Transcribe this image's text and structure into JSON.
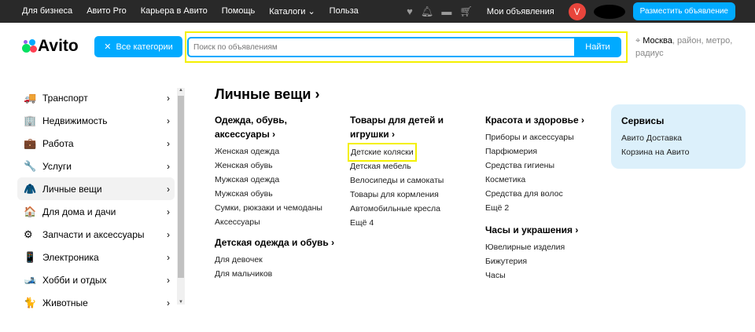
{
  "topbar": {
    "links": [
      "Для бизнеса",
      "Авито Pro",
      "Карьера в Авито",
      "Помощь",
      "Каталоги ⌄",
      "Польза"
    ],
    "my_ads": "Мои объявления",
    "avatar_letter": "V",
    "post_button": "Разместить объявление",
    "icons": [
      "heart-icon",
      "bell-icon",
      "chat-icon",
      "cart-icon"
    ]
  },
  "header": {
    "logo": "Avito",
    "categories_button": "Все категории",
    "search_placeholder": "Поиск по объявлениям",
    "search_button": "Найти",
    "location_city": "Москва",
    "location_rest": ", район, метро, радиус"
  },
  "sidebar": {
    "items": [
      {
        "label": "Транспорт",
        "icon": "🚚"
      },
      {
        "label": "Недвижимость",
        "icon": "🏢"
      },
      {
        "label": "Работа",
        "icon": "💼"
      },
      {
        "label": "Услуги",
        "icon": "🔧"
      },
      {
        "label": "Личные вещи",
        "icon": "🧥",
        "active": true
      },
      {
        "label": "Для дома и дачи",
        "icon": "🏠"
      },
      {
        "label": "Запчасти и аксессуары",
        "icon": "⚙"
      },
      {
        "label": "Электроника",
        "icon": "📱"
      },
      {
        "label": "Хобби и отдых",
        "icon": "🎿"
      },
      {
        "label": "Животные",
        "icon": "🐈"
      }
    ]
  },
  "main": {
    "title": "Личные вещи ›",
    "groups": [
      {
        "title": "Одежда, обувь, аксессуары ›",
        "links": [
          "Женская одежда",
          "Женская обувь",
          "Мужская одежда",
          "Мужская обувь",
          "Сумки, рюкзаки и чемоданы",
          "Аксессуары"
        ]
      },
      {
        "title": "Детская одежда и обувь ›",
        "links": [
          "Для девочек",
          "Для мальчиков"
        ]
      },
      {
        "title": "Товары для детей и игрушки ›",
        "links": [
          "Детские коляски",
          "Детская мебель",
          "Велосипеды и самокаты",
          "Товары для кормления",
          "Автомобильные кресла",
          "Ещё 4"
        ]
      },
      {
        "title": "Красота и здоровье ›",
        "links": [
          "Приборы и аксессуары",
          "Парфюмерия",
          "Средства гигиены",
          "Косметика",
          "Средства для волос",
          "Ещё 2"
        ]
      },
      {
        "title": "Часы и украшения ›",
        "links": [
          "Ювелирные изделия",
          "Бижутерия",
          "Часы"
        ]
      }
    ],
    "services": {
      "title": "Сервисы",
      "links": [
        "Авито Доставка",
        "Корзина на Авито"
      ]
    }
  }
}
